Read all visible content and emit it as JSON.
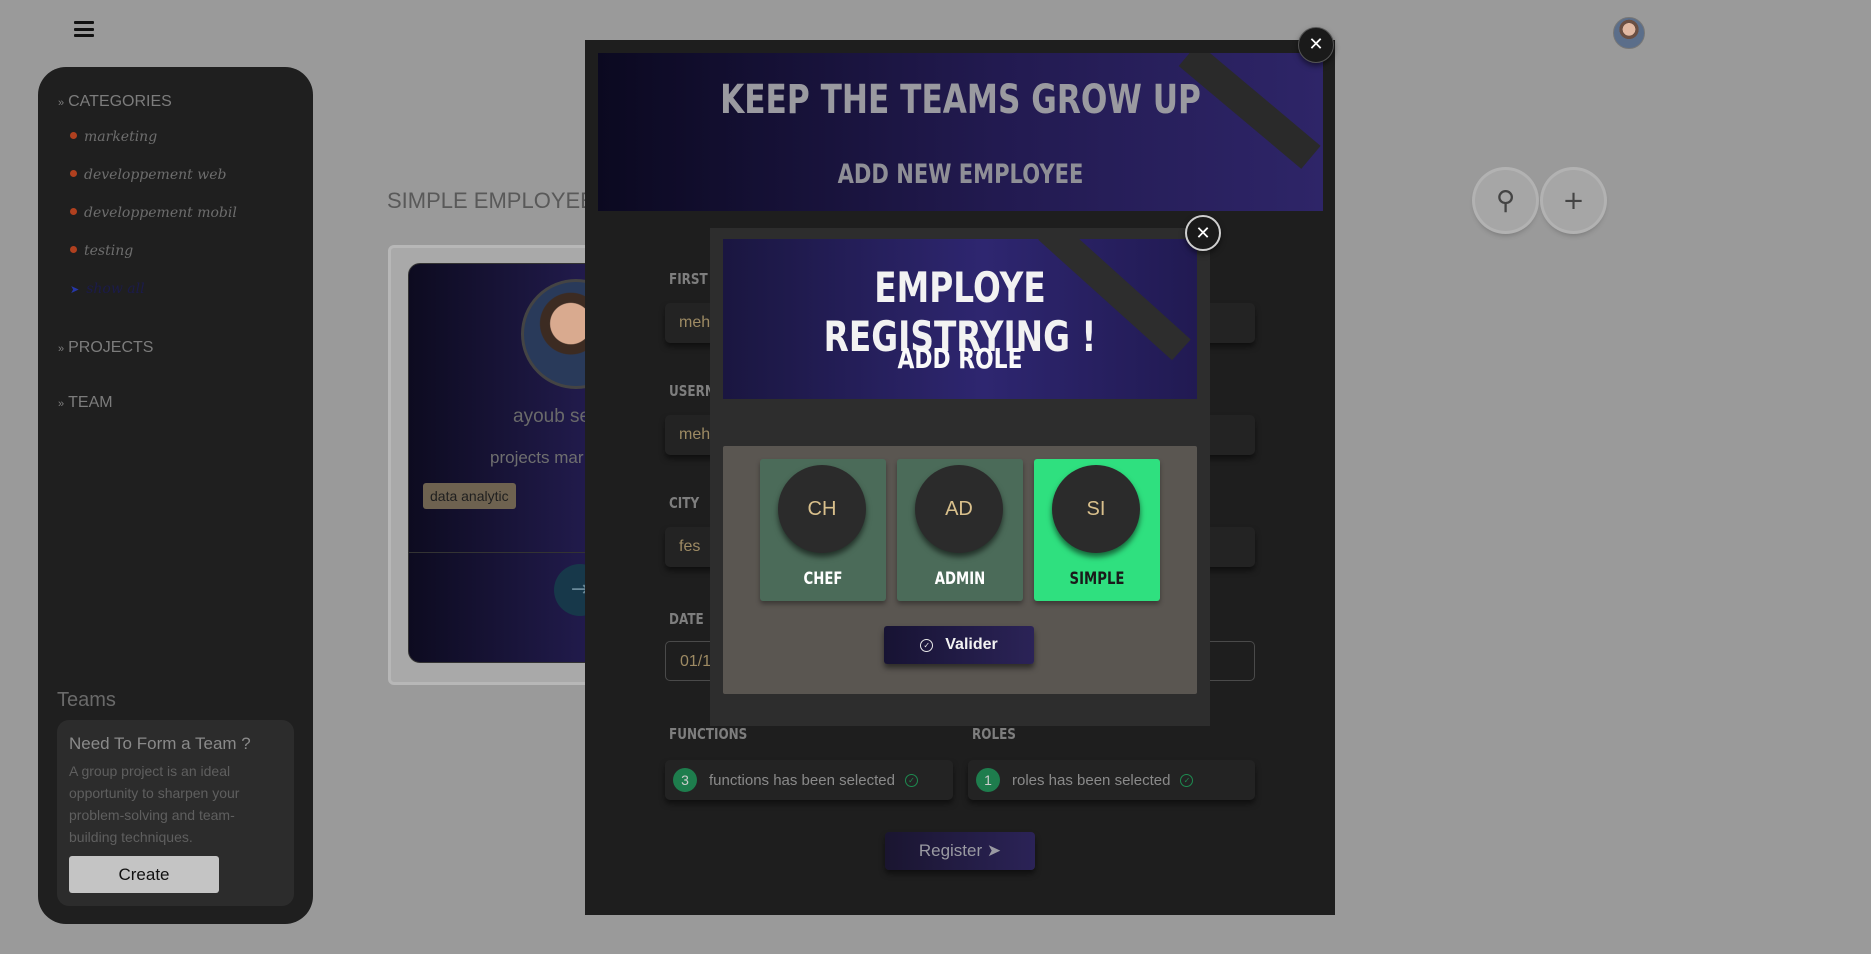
{
  "topbar": {
    "menu_icon": "hamburger-icon",
    "avatar_icon": "user-avatar"
  },
  "sidebar": {
    "categories_label": "CATEGORIES",
    "categories": [
      "marketing",
      "developpement web",
      "developpement mobil",
      "testing",
      "show all"
    ],
    "projects_label": "PROJECTS",
    "team_label": "TEAM",
    "teams_heading": "Teams",
    "team_card": {
      "title": "Need To Form a Team ?",
      "text": "A group project is an ideal opportunity to sharpen your problem-solving and team-building techniques.",
      "button": "Create"
    }
  },
  "page": {
    "title": "SIMPLE EMPLOYEE",
    "search_icon": "search-icon",
    "add_icon": "plus-icon",
    "employee": {
      "name": "ayoub se",
      "role": "projects mar",
      "tag": "data analytic"
    }
  },
  "modal": {
    "title": "KEEP THE TEAMS GROW UP",
    "subtitle": "ADD NEW EMPLOYEE",
    "close": "✕",
    "fields": {
      "first_name_label": "FIRST N",
      "first_name_value": "meh",
      "username_label": "USERNA",
      "username_value": "meh",
      "city_label": "CITY",
      "city_value": "fes",
      "date_label": "DATE",
      "date_value": "01/1"
    },
    "functions": {
      "label": "FUNCTIONS",
      "count": "3",
      "text": "functions has been selected"
    },
    "roles": {
      "label": "ROLES",
      "count": "1",
      "text": "roles has been selected"
    },
    "register": "Register"
  },
  "inner_modal": {
    "title": "EMPLOYE REGISTRYING !",
    "subtitle": "ADD ROLE",
    "close": "✕",
    "roles": [
      {
        "abbr": "CH",
        "name": "CHEF",
        "selected": false
      },
      {
        "abbr": "AD",
        "name": "ADMIN",
        "selected": false
      },
      {
        "abbr": "SI",
        "name": "SIMPLE",
        "selected": true
      }
    ],
    "valider": "Valider"
  }
}
